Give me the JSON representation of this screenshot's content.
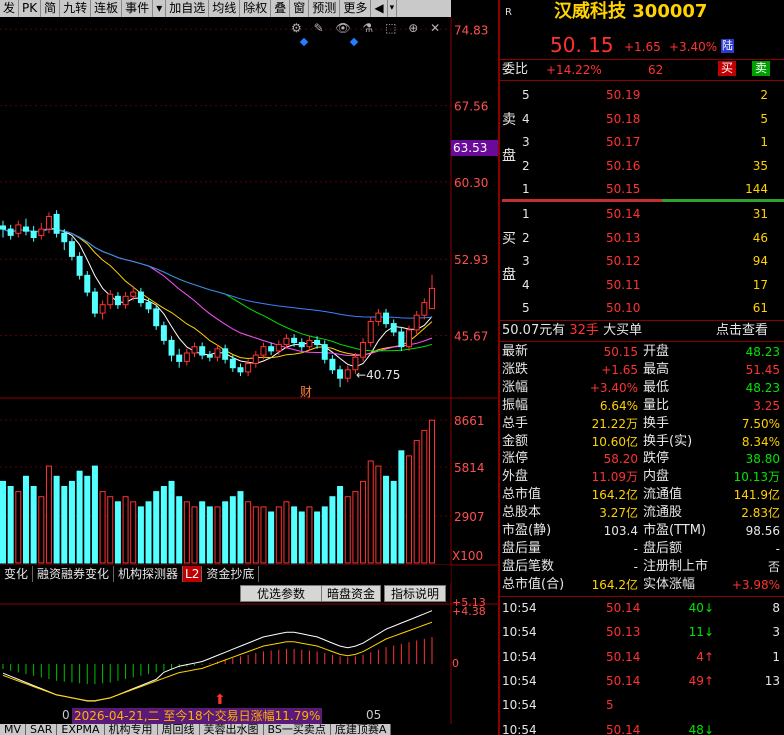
{
  "toolbar": {
    "items": [
      "发",
      "PK",
      "简",
      "九转",
      "连板",
      "事件",
      "▾",
      "加自选",
      "均线",
      "除权",
      "叠",
      "窗",
      "预测",
      "更多"
    ],
    "arrow_right": "◀",
    "arrow_down": "▾"
  },
  "stock": {
    "badge": "R",
    "name": "汉威科技 300007",
    "price": "50. 15",
    "change": "+1.65",
    "change_pct": "+3.40%",
    "market": "陆"
  },
  "weibi": {
    "label": "委比",
    "value": "+14.22%",
    "diff": "62",
    "buy": "买",
    "sell": "卖"
  },
  "sell_label": [
    "卖",
    "盘"
  ],
  "buy_label": [
    "买",
    "盘"
  ],
  "asks": [
    {
      "level": "5",
      "price": "50.19",
      "vol": "2"
    },
    {
      "level": "4",
      "price": "50.18",
      "vol": "5"
    },
    {
      "level": "3",
      "price": "50.17",
      "vol": "1"
    },
    {
      "level": "2",
      "price": "50.16",
      "vol": "35"
    },
    {
      "level": "1",
      "price": "50.15",
      "vol": "144"
    }
  ],
  "bids": [
    {
      "level": "1",
      "price": "50.14",
      "vol": "31"
    },
    {
      "level": "2",
      "price": "50.13",
      "vol": "46"
    },
    {
      "level": "3",
      "price": "50.12",
      "vol": "94"
    },
    {
      "level": "4",
      "price": "50.11",
      "vol": "17"
    },
    {
      "level": "5",
      "price": "50.10",
      "vol": "61"
    }
  ],
  "bigorder": {
    "price": "50.07",
    "unit": "元有",
    "qty": "32手",
    "kind": "大买单",
    "link": "点击查看"
  },
  "quote_rows": [
    {
      "l1": "最新",
      "v1": "50.15",
      "c1": "red",
      "l2": "开盘",
      "v2": "48.23",
      "c2": "grn"
    },
    {
      "l1": "涨跌",
      "v1": "+1.65",
      "c1": "red",
      "l2": "最高",
      "v2": "51.45",
      "c2": "red"
    },
    {
      "l1": "涨幅",
      "v1": "+3.40%",
      "c1": "red",
      "l2": "最低",
      "v2": "48.23",
      "c2": "grn"
    },
    {
      "l1": "振幅",
      "v1": "6.64%",
      "c1": "yel",
      "l2": "量比",
      "v2": "3.25",
      "c2": "red"
    },
    {
      "l1": "总手",
      "v1": "21.22万",
      "c1": "yel",
      "l2": "换手",
      "v2": "7.50%",
      "c2": "yel"
    },
    {
      "l1": "金额",
      "v1": "10.60亿",
      "c1": "yel",
      "l2": "换手(实)",
      "v2": "8.34%",
      "c2": "yel"
    },
    {
      "l1": "涨停",
      "v1": "58.20",
      "c1": "red",
      "l2": "跌停",
      "v2": "38.80",
      "c2": "grn"
    },
    {
      "l1": "外盘",
      "v1": "11.09万",
      "c1": "red",
      "l2": "内盘",
      "v2": "10.13万",
      "c2": "grn"
    },
    {
      "l1": "总市值",
      "v1": "164.2亿",
      "c1": "yel",
      "l2": "流通值",
      "v2": "141.9亿",
      "c2": "yel"
    },
    {
      "l1": "总股本",
      "v1": "3.27亿",
      "c1": "yel",
      "l2": "流通股",
      "v2": "2.83亿",
      "c2": "yel"
    },
    {
      "l1": "市盈(静)",
      "v1": "103.4",
      "c1": "wht",
      "l2": "市盈(TTM)",
      "v2": "98.56",
      "c2": "wht"
    },
    {
      "l1": "盘后量",
      "v1": "-",
      "c1": "wht",
      "l2": "盘后额",
      "v2": "-",
      "c2": "wht"
    },
    {
      "l1": "盘后笔数",
      "v1": "-",
      "c1": "wht",
      "l2": "注册制上市",
      "v2": "否",
      "c2": "wht"
    },
    {
      "l1": "总市值(合)",
      "v1": "164.2亿",
      "c1": "yel",
      "l2": "实体涨幅",
      "v2": "+3.98%",
      "c2": "red"
    }
  ],
  "ticks": [
    {
      "time": "10:54",
      "price": "50.14",
      "vol": "40",
      "dir": "↓",
      "n": "8",
      "vc": "grn"
    },
    {
      "time": "10:54",
      "price": "50.13",
      "vol": "11",
      "dir": "↓",
      "n": "3",
      "vc": "grn"
    },
    {
      "time": "10:54",
      "price": "50.14",
      "vol": "4",
      "dir": "↑",
      "n": "1",
      "vc": "red"
    },
    {
      "time": "10:54",
      "price": "50.14",
      "vol": "49",
      "dir": "↑",
      "n": "13",
      "vc": "red"
    },
    {
      "time": "10:54",
      "price": "5",
      "vol": "",
      "dir": "",
      "n": "",
      "vc": "red"
    },
    {
      "time": "10:54",
      "price": "50.14",
      "vol": "48",
      "dir": "↓",
      "n": "",
      "vc": "grn"
    }
  ],
  "price_axis": [
    "74.83",
    "67.56",
    "60.30",
    "52.93",
    "45.67"
  ],
  "cursor_price": "63.53",
  "low_label": "40.75",
  "cai": "财",
  "vol_axis": [
    "8661",
    "5814",
    "2907",
    "X100"
  ],
  "tabs": [
    "变化",
    "融资融券变化",
    "机构探测器",
    "L2",
    "资金抄底"
  ],
  "option_buttons": [
    "优选参数",
    "暗盘资金",
    "指标说明"
  ],
  "macd_axis": [
    "5.13",
    "4.38",
    "0"
  ],
  "event_text": "2026-04-21,二 至今18个交易日涨幅11.79%",
  "date_labels": [
    "0",
    "05"
  ],
  "bottom_tabs": [
    "MV",
    "SAR",
    "EXPMA",
    "机构专用",
    "周回线",
    "芙蓉出水图",
    "BS一买卖点",
    "底建顶赛A"
  ],
  "chart_data": {
    "type": "candlestick",
    "price_range": [
      40,
      76
    ],
    "candles": [
      [
        56.1,
        55.8,
        56.6,
        55.0
      ],
      [
        55.8,
        55.2,
        56.2,
        54.8
      ],
      [
        55.4,
        56.2,
        56.6,
        55.0
      ],
      [
        56.0,
        55.6,
        56.8,
        55.2
      ],
      [
        55.6,
        55.0,
        56.1,
        54.6
      ],
      [
        55.2,
        55.8,
        56.4,
        54.8
      ],
      [
        55.8,
        57.0,
        57.4,
        55.4
      ],
      [
        57.2,
        55.4,
        57.6,
        55.0
      ],
      [
        55.4,
        54.6,
        55.8,
        53.8
      ],
      [
        54.6,
        53.2,
        55.0,
        52.8
      ],
      [
        53.2,
        51.4,
        53.6,
        51.0
      ],
      [
        51.4,
        49.8,
        51.8,
        49.4
      ],
      [
        49.8,
        47.8,
        50.2,
        47.4
      ],
      [
        47.8,
        48.6,
        49.0,
        47.2
      ],
      [
        48.6,
        49.6,
        50.0,
        48.2
      ],
      [
        49.4,
        48.6,
        49.8,
        48.2
      ],
      [
        48.6,
        49.4,
        49.8,
        48.2
      ],
      [
        49.4,
        49.8,
        50.4,
        49.0
      ],
      [
        49.8,
        48.8,
        50.2,
        48.4
      ],
      [
        48.8,
        48.2,
        49.2,
        47.8
      ],
      [
        48.2,
        46.6,
        48.6,
        46.2
      ],
      [
        46.6,
        45.2,
        47.0,
        44.8
      ],
      [
        45.2,
        43.8,
        45.6,
        43.2
      ],
      [
        43.8,
        43.2,
        44.4,
        42.6
      ],
      [
        43.2,
        44.0,
        44.4,
        42.8
      ],
      [
        44.0,
        44.6,
        45.0,
        43.6
      ],
      [
        44.6,
        43.8,
        45.0,
        43.4
      ],
      [
        43.8,
        43.6,
        44.2,
        43.2
      ],
      [
        43.6,
        44.4,
        44.8,
        43.2
      ],
      [
        44.4,
        43.4,
        44.8,
        43.0
      ],
      [
        43.4,
        42.6,
        43.8,
        42.2
      ],
      [
        42.6,
        42.2,
        43.0,
        41.8
      ],
      [
        42.2,
        43.0,
        43.4,
        41.8
      ],
      [
        43.0,
        43.8,
        44.2,
        42.6
      ],
      [
        43.8,
        44.6,
        45.0,
        43.4
      ],
      [
        44.6,
        44.2,
        45.0,
        43.8
      ],
      [
        44.2,
        44.8,
        45.2,
        43.8
      ],
      [
        44.8,
        45.4,
        45.8,
        44.4
      ],
      [
        45.4,
        45.0,
        45.8,
        44.6
      ],
      [
        45.0,
        44.6,
        45.4,
        44.2
      ],
      [
        44.6,
        45.2,
        45.6,
        44.2
      ],
      [
        45.2,
        44.8,
        45.6,
        44.4
      ],
      [
        44.8,
        43.4,
        45.2,
        43.0
      ],
      [
        43.4,
        42.4,
        43.8,
        42.0
      ],
      [
        42.4,
        41.6,
        42.8,
        40.75
      ],
      [
        41.6,
        42.4,
        42.8,
        41.2
      ],
      [
        42.4,
        43.6,
        44.0,
        42.0
      ],
      [
        43.6,
        45.0,
        45.4,
        43.2
      ],
      [
        45.0,
        47.0,
        47.4,
        44.6
      ],
      [
        47.0,
        47.8,
        48.2,
        46.6
      ],
      [
        47.8,
        46.8,
        48.2,
        46.4
      ],
      [
        46.8,
        46.0,
        47.2,
        45.6
      ],
      [
        46.0,
        44.6,
        46.4,
        44.2
      ],
      [
        44.6,
        46.2,
        46.6,
        44.2
      ],
      [
        46.2,
        47.6,
        48.0,
        45.8
      ],
      [
        47.6,
        48.8,
        49.2,
        47.2
      ],
      [
        48.23,
        50.15,
        51.45,
        48.23
      ]
    ],
    "volumes": [
      32,
      30,
      28,
      34,
      30,
      26,
      38,
      34,
      30,
      32,
      36,
      34,
      38,
      28,
      26,
      24,
      26,
      24,
      22,
      24,
      28,
      30,
      32,
      26,
      24,
      22,
      24,
      22,
      22,
      24,
      26,
      28,
      24,
      22,
      22,
      20,
      22,
      24,
      22,
      20,
      22,
      20,
      22,
      26,
      30,
      26,
      28,
      32,
      40,
      38,
      34,
      32,
      44,
      42,
      48,
      52,
      56
    ],
    "macd": [
      -0.6,
      -0.8,
      -1.0,
      -1.2,
      -1.4,
      -1.6,
      -1.8,
      -2.0,
      -2.1,
      -2.2,
      -2.3,
      -2.4,
      -2.4,
      -2.3,
      -2.2,
      -2.0,
      -1.8,
      -1.6,
      -1.4,
      -1.2,
      -1.0,
      -0.8,
      -0.6,
      -0.4,
      -0.3,
      -0.2,
      -0.1,
      0.1,
      0.3,
      0.5,
      0.7,
      0.9,
      1.1,
      1.3,
      1.5,
      1.6,
      1.7,
      1.8,
      1.8,
      1.7,
      1.6,
      1.5,
      1.3,
      1.1,
      0.9,
      0.8,
      0.9,
      1.1,
      1.4,
      1.7,
      2.0,
      2.2,
      2.4,
      2.6,
      2.8,
      3.0,
      3.2
    ]
  }
}
